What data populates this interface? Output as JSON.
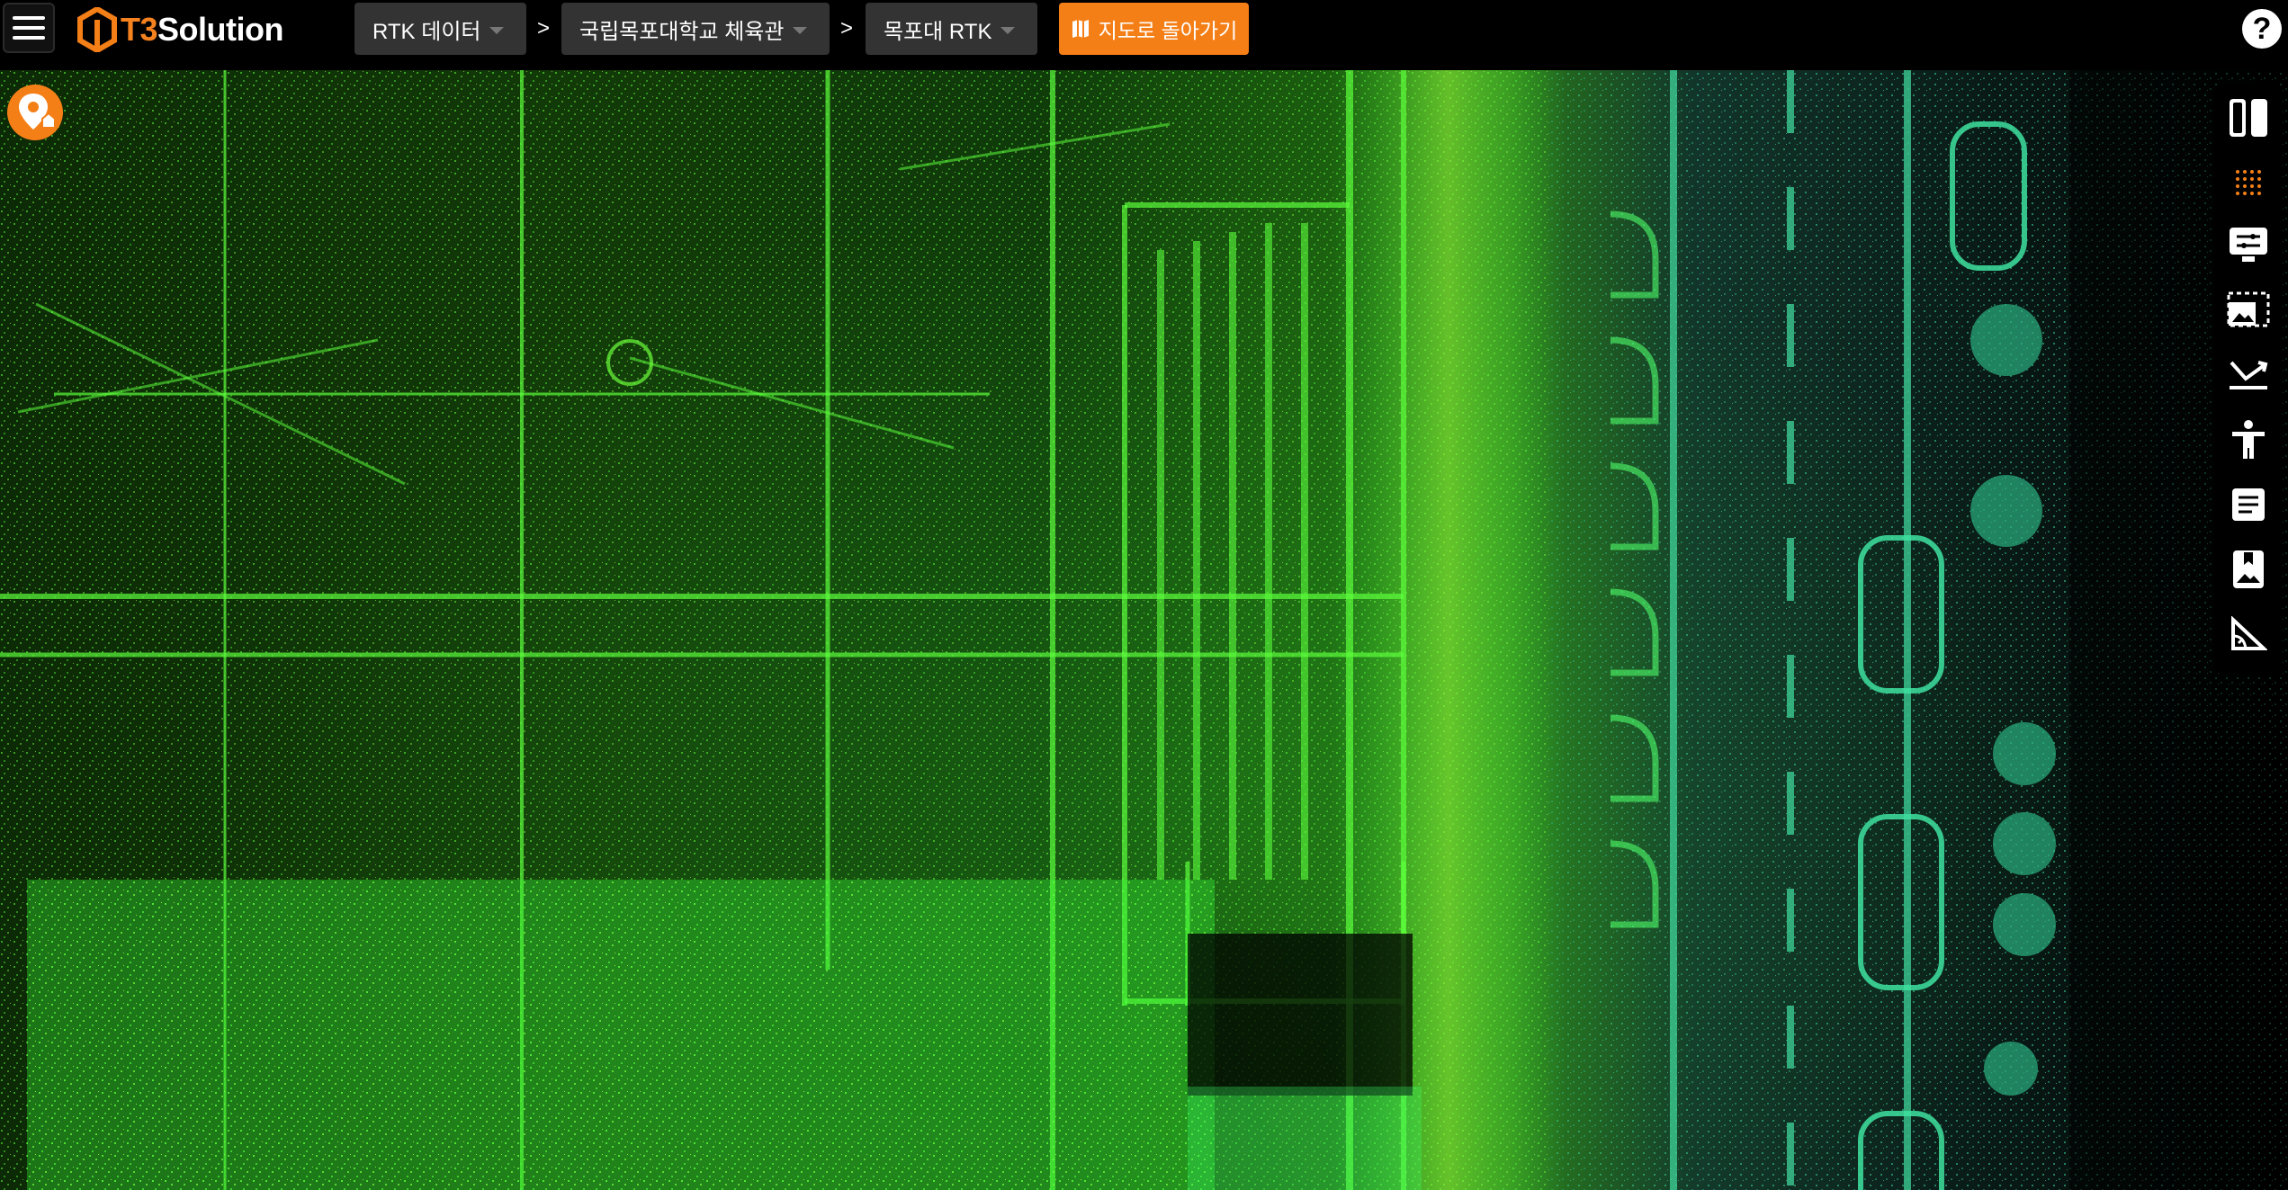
{
  "app": {
    "brand_prefix": "T3",
    "brand_suffix": "Solution"
  },
  "header": {
    "breadcrumbs": [
      {
        "label": "RTK 데이터"
      },
      {
        "label": "국립목포대학교 체육관"
      },
      {
        "label": "목포대 RTK"
      }
    ],
    "separator": ">",
    "back_to_map_label": "지도로 돌아가기",
    "help_label": "?"
  },
  "colors": {
    "accent": "#f57f17",
    "point_green": "#3cff3c",
    "point_teal": "#2fbf8a"
  },
  "icons": {
    "menu": "hamburger-icon",
    "back": "map-icon",
    "pin": "map-pin-home-icon",
    "help": "help-icon"
  },
  "toolbar": {
    "tools": [
      {
        "icon": "split-view-icon"
      },
      {
        "icon": "point-cloud-icon"
      },
      {
        "icon": "monitor-settings-icon"
      },
      {
        "icon": "image-region-icon"
      },
      {
        "icon": "crop-angle-icon"
      },
      {
        "icon": "person-icon"
      },
      {
        "icon": "document-icon"
      },
      {
        "icon": "bookmark-image-icon"
      },
      {
        "icon": "measure-angle-icon"
      }
    ]
  }
}
